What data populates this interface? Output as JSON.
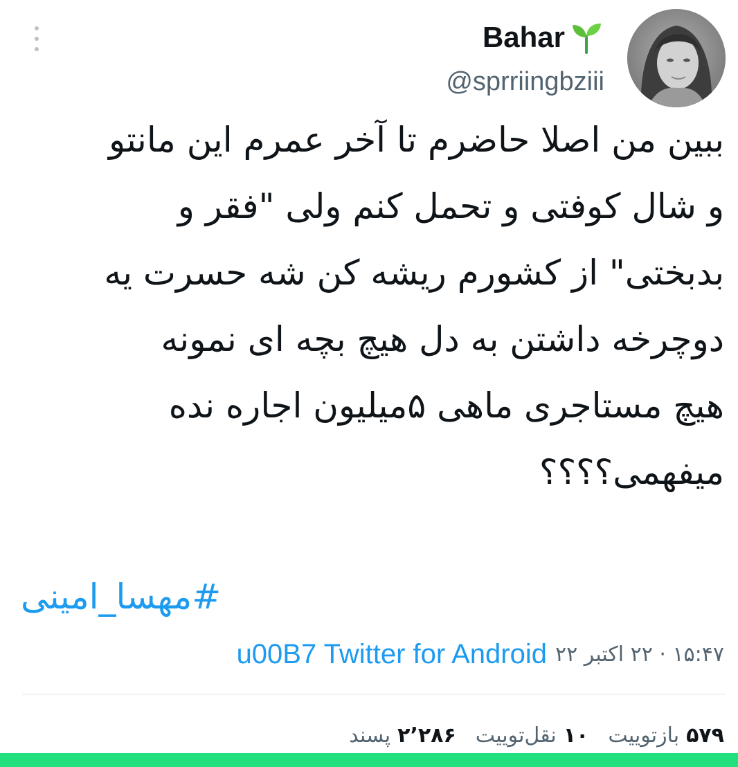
{
  "header": {
    "display_name": "Bahar",
    "name_emoji": "seedling-icon",
    "handle": "@sprriingbziii",
    "avatar": "avatar-photo",
    "more_icon": "more-vertical-icon"
  },
  "tweet": {
    "lines": [
      "ببین من اصلا حاضرم تا آخر عمرم این مانتو",
      "و شال کوفتی و تحمل کنم ولی \"فقر و",
      "بدبختی\" از کشورم ریشه کن شه حسرت یه",
      "دوچرخه داشتن به دل هیچ بچه ای نمونه",
      "هیچ مستاجری ماهی ۵میلیون اجاره نده",
      "میفهمی؟؟؟؟"
    ],
    "hashtag": "#مهسا_امینی"
  },
  "meta": {
    "datetime": "۱۵:۴۷ · ۲۲ اکتبر ۲۲",
    "separator": "u00B7",
    "source": "Twitter for Android"
  },
  "stats": [
    {
      "value": "۵۷۹",
      "label": "بازتوییت"
    },
    {
      "value": "۱۰",
      "label": "نقل‌توییت"
    },
    {
      "value": "۲٬۲۸۶",
      "label": "پسند"
    }
  ],
  "colors": {
    "accent": "#1d9bf0",
    "text": "#0f1419",
    "secondary": "#536471",
    "bottom_bar": "#22e07d"
  }
}
